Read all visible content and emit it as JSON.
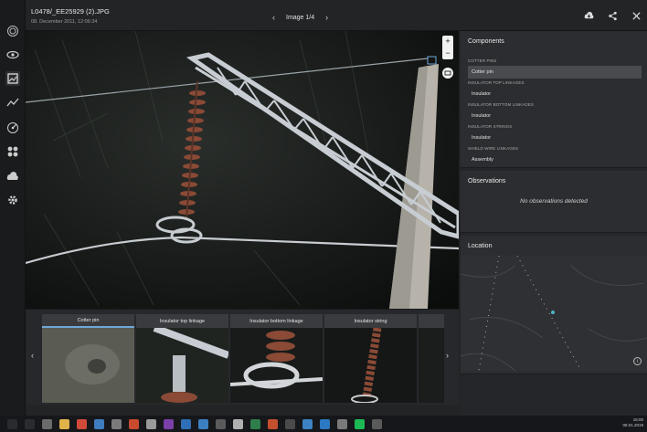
{
  "header": {
    "filename": "L0478/_EE25929 (2).JPG",
    "datetime": "08. December 2011, 12:06:34",
    "pager": "Image 1/4",
    "prev": "‹",
    "next": "›"
  },
  "zoom": {
    "plus": "+",
    "minus": "−"
  },
  "thumbnails": [
    {
      "label": "Cotter pin",
      "selected": true
    },
    {
      "label": "Insulator top linkage",
      "selected": false
    },
    {
      "label": "Insulator bottom linkage",
      "selected": false
    },
    {
      "label": "Insulator string",
      "selected": false
    }
  ],
  "strip_nav": {
    "prev": "‹",
    "next": "›"
  },
  "components": {
    "title": "Components",
    "groups": [
      {
        "caption": "COTTER PINS",
        "item": "Cotter pin",
        "selected": true
      },
      {
        "caption": "INSULATOR TOP LINKAGES",
        "item": "Insulator",
        "selected": false
      },
      {
        "caption": "INSULATOR BOTTOM LINKAGES",
        "item": "Insulator",
        "selected": false
      },
      {
        "caption": "INSULATOR STRINGS",
        "item": "Insulator",
        "selected": false
      },
      {
        "caption": "SHIELD WIRE LINKAGES",
        "item": "Assembly",
        "selected": false
      }
    ]
  },
  "observations": {
    "title": "Observations",
    "empty": "No observations detected"
  },
  "location": {
    "title": "Location",
    "info": "i"
  },
  "taskbar": {
    "time": "15:00",
    "date": "08.01.2019"
  },
  "colors": {
    "accent": "#6fa8d8",
    "insulator": "#8a4a36",
    "steel": "#c7cdd2"
  }
}
